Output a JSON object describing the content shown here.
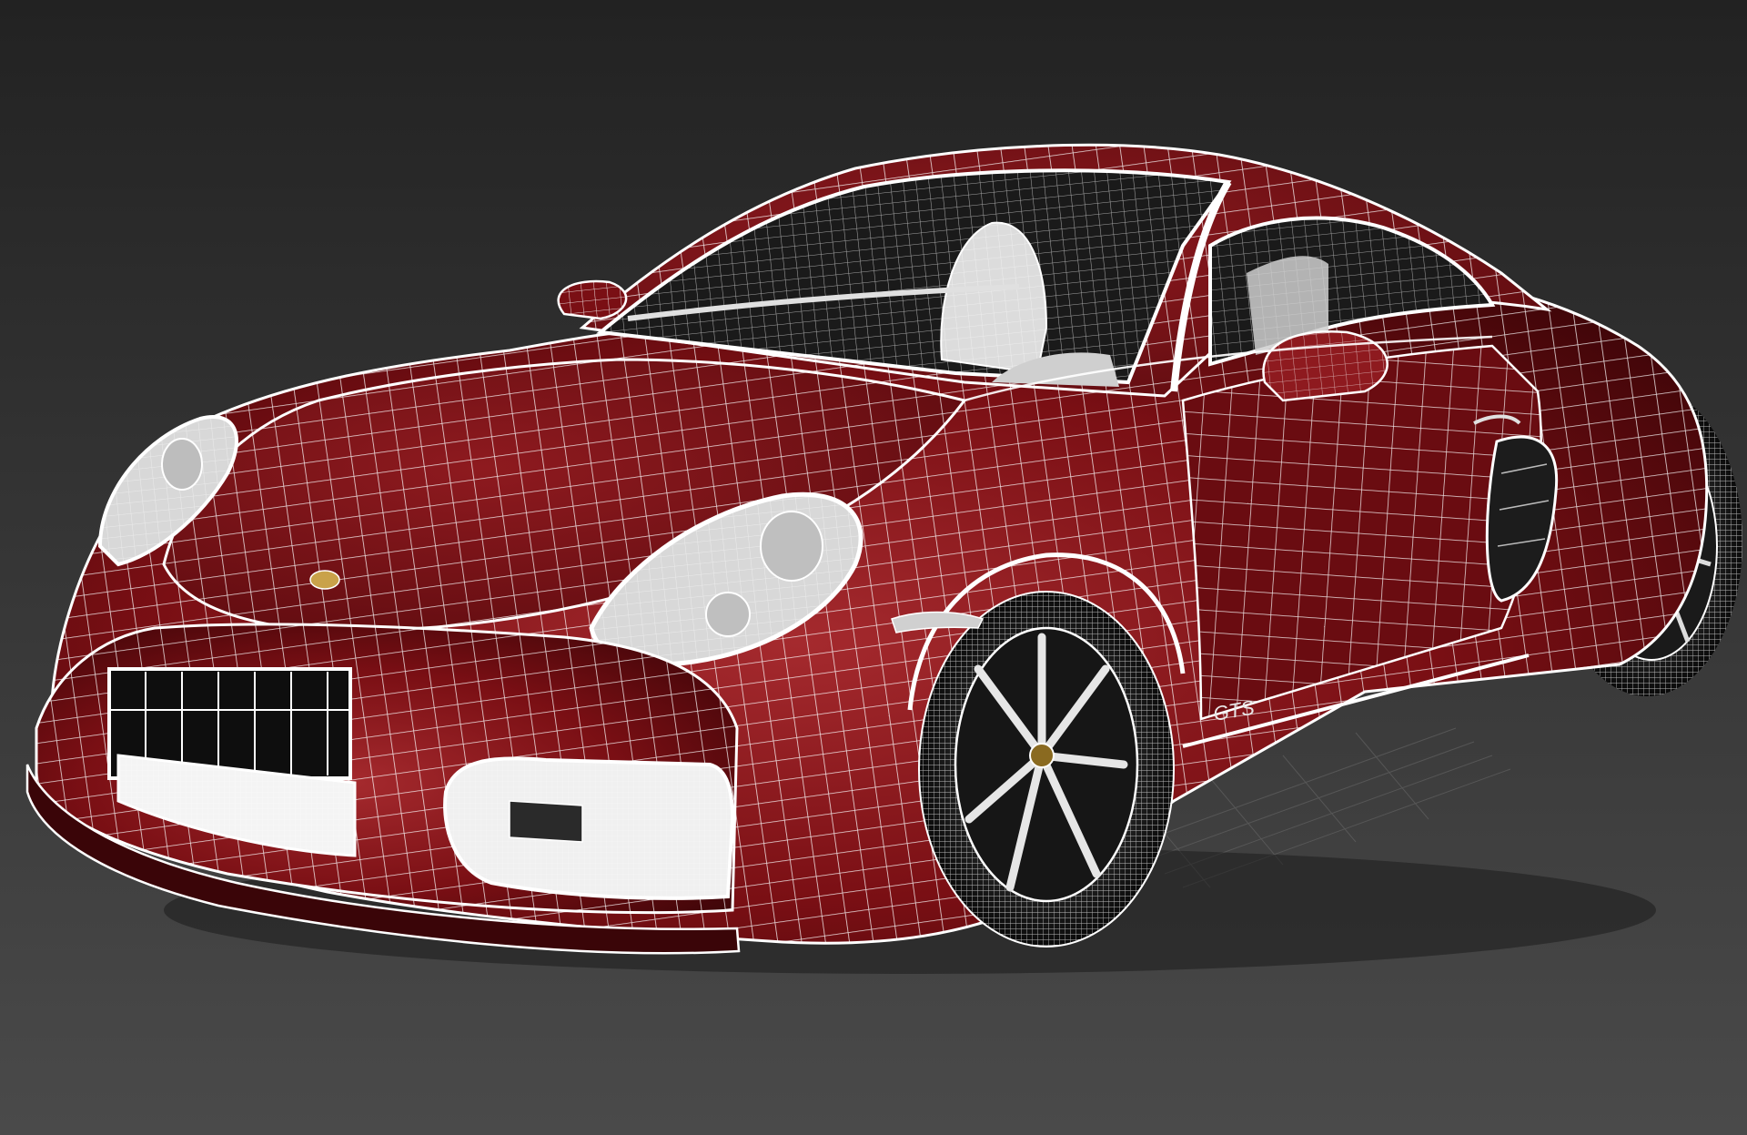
{
  "viewport": {
    "shading_mode": "smooth-shaded-with-wireframe",
    "background_gradient": {
      "top": "#222222",
      "bottom": "#4a4a4a"
    },
    "grid_visible": true,
    "grid_color": "#6a6a6a"
  },
  "model": {
    "object": "sports-car-coupe",
    "body_color": "#7a0f14",
    "body_highlight": "#a52a2e",
    "body_shadow": "#3d0508",
    "wire_color": "#ffffff",
    "glass_color": "#1a1a1a",
    "interior_color": "#dcdcdc",
    "wheel_color": "#151515",
    "hub_color": "#8a6a20",
    "side_badge": "GTS"
  }
}
